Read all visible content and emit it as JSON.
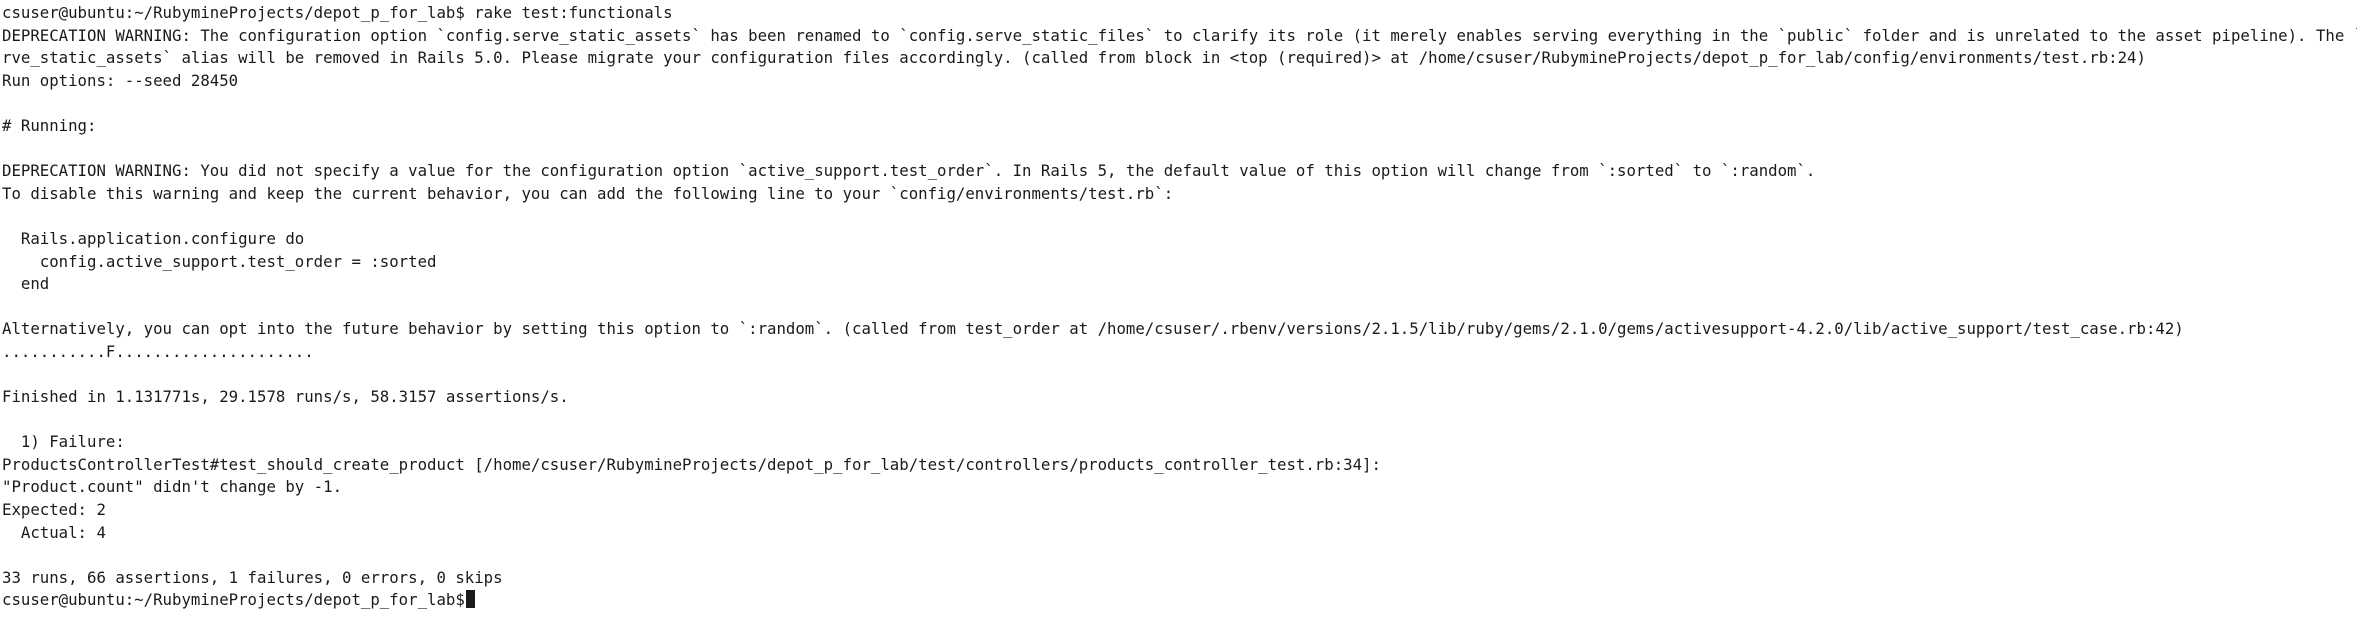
{
  "terminal": {
    "lines": [
      "csuser@ubuntu:~/RubymineProjects/depot_p_for_lab$ rake test:functionals",
      "DEPRECATION WARNING: The configuration option `config.serve_static_assets` has been renamed to `config.serve_static_files` to clarify its role (it merely enables serving everything in the `public` folder and is unrelated to the asset pipeline). The `se",
      "rve_static_assets` alias will be removed in Rails 5.0. Please migrate your configuration files accordingly. (called from block in <top (required)> at /home/csuser/RubymineProjects/depot_p_for_lab/config/environments/test.rb:24)",
      "Run options: --seed 28450",
      "",
      "# Running:",
      "",
      "DEPRECATION WARNING: You did not specify a value for the configuration option `active_support.test_order`. In Rails 5, the default value of this option will change from `:sorted` to `:random`.",
      "To disable this warning and keep the current behavior, you can add the following line to your `config/environments/test.rb`:",
      "",
      "  Rails.application.configure do",
      "    config.active_support.test_order = :sorted",
      "  end",
      "",
      "Alternatively, you can opt into the future behavior by setting this option to `:random`. (called from test_order at /home/csuser/.rbenv/versions/2.1.5/lib/ruby/gems/2.1.0/gems/activesupport-4.2.0/lib/active_support/test_case.rb:42)",
      "...........F.....................",
      "",
      "Finished in 1.131771s, 29.1578 runs/s, 58.3157 assertions/s.",
      "",
      "  1) Failure:",
      "ProductsControllerTest#test_should_create_product [/home/csuser/RubymineProjects/depot_p_for_lab/test/controllers/products_controller_test.rb:34]:",
      "\"Product.count\" didn't change by -1.",
      "Expected: 2",
      "  Actual: 4",
      "",
      "33 runs, 66 assertions, 1 failures, 0 errors, 0 skips",
      "csuser@ubuntu:~/RubymineProjects/depot_p_for_lab$"
    ]
  }
}
